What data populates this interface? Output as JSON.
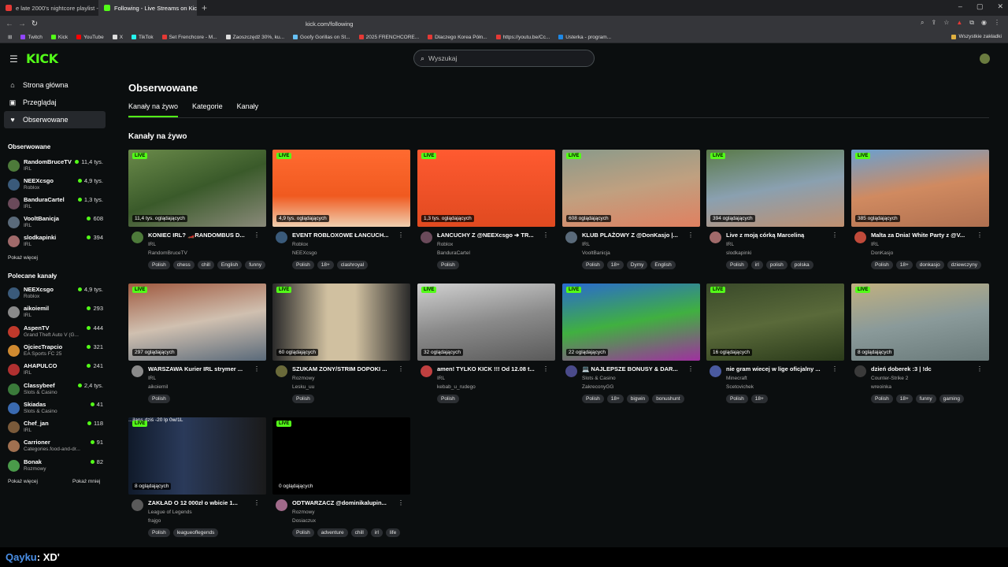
{
  "browser": {
    "tabs": [
      {
        "title": "e late 2000's nightcore playlist -",
        "active": false,
        "color": "#e53935"
      },
      {
        "title": "Following - Live Streams on Kick",
        "active": true,
        "color": "#53fc18"
      }
    ],
    "url": "kick.com/following",
    "bookmarks": [
      {
        "label": "Twitch",
        "color": "#9146ff"
      },
      {
        "label": "Kick",
        "color": "#53fc18"
      },
      {
        "label": "YouTube",
        "color": "#ff0000"
      },
      {
        "label": "X",
        "color": "#dddddd"
      },
      {
        "label": "TikTok",
        "color": "#25f4ee"
      },
      {
        "label": "Set Frenchcore - M...",
        "color": "#e53935"
      },
      {
        "label": "Zaoszczędź 30%, ku...",
        "color": "#dddddd"
      },
      {
        "label": "Goofy Gorillas on St...",
        "color": "#66c0f4"
      },
      {
        "label": "2025 FRENCHCORE...",
        "color": "#e53935"
      },
      {
        "label": "Dlaczego Korea Półn...",
        "color": "#e53935"
      },
      {
        "label": "https://youtu.be/Cc...",
        "color": "#e53935"
      },
      {
        "label": "Usterka - program...",
        "color": "#1e88e5"
      }
    ],
    "all_bookmarks": "Wszystkie zakładki"
  },
  "header": {
    "logo": "KICK",
    "search_placeholder": "Wyszukaj"
  },
  "sidebar": {
    "nav": [
      {
        "label": "Strona główna",
        "icon": "home-icon",
        "glyph": "⌂"
      },
      {
        "label": "Przeglądaj",
        "icon": "browse-icon",
        "glyph": "▣"
      },
      {
        "label": "Obserwowane",
        "icon": "heart-icon",
        "glyph": "♥"
      }
    ],
    "followed_title": "Obserwowane",
    "followed": [
      {
        "name": "RandomBruceTV",
        "category": "IRL",
        "viewers": "11,4 tys.",
        "color": "#4d7a3a"
      },
      {
        "name": "NEEXcsgo",
        "category": "Roblox",
        "viewers": "4,9 tys.",
        "color": "#3a5a7a"
      },
      {
        "name": "BanduraCartel",
        "category": "IRL",
        "viewers": "1,3 tys.",
        "color": "#6a4a5a"
      },
      {
        "name": "VooltBanicja",
        "category": "IRL",
        "viewers": "608",
        "color": "#5a6a7a"
      },
      {
        "name": "slodkapinki",
        "category": "IRL",
        "viewers": "394",
        "color": "#a06a6a"
      }
    ],
    "show_more": "Pokaż więcej",
    "recommended_title": "Polecane kanały",
    "recommended": [
      {
        "name": "NEEXcsgo",
        "category": "Roblox",
        "viewers": "4,9 tys.",
        "color": "#3a5a7a"
      },
      {
        "name": "aikoiemil",
        "category": "IRL",
        "viewers": "293",
        "color": "#8a8a8a"
      },
      {
        "name": "AspenTV",
        "category": "Grand Theft Auto V (G...",
        "viewers": "444",
        "color": "#c0392b"
      },
      {
        "name": "OjciecTrapcio",
        "category": "EA Sports FC 25",
        "viewers": "321",
        "color": "#d08a30"
      },
      {
        "name": "AHAPULCO",
        "category": "IRL",
        "viewers": "241",
        "color": "#b03030"
      },
      {
        "name": "Classybeef",
        "category": "Slots & Casino",
        "viewers": "2,4 tys.",
        "color": "#3a7a3a"
      },
      {
        "name": "Skiadas",
        "category": "Slots & Casino",
        "viewers": "41",
        "color": "#3a6ab0"
      },
      {
        "name": "Chef_jan",
        "category": "IRL",
        "viewers": "118",
        "color": "#7a5a3a"
      },
      {
        "name": "Carrioner",
        "category": "Categories.food-and-dr...",
        "viewers": "91",
        "color": "#a07050"
      },
      {
        "name": "Bonak",
        "category": "Rozmowy",
        "viewers": "82",
        "color": "#4a9a4a"
      }
    ],
    "show_more_2": "Pokaż więcej",
    "show_less": "Pokaż mniej"
  },
  "main": {
    "title": "Obserwowane",
    "tabs": [
      "Kanały na żywo",
      "Kategorie",
      "Kanały"
    ],
    "section_title": "Kanały na żywo",
    "live_label": "LIVE",
    "cards": [
      {
        "title": "KONIEC IRL? 🏎️RANDOMBUS D...",
        "category": "IRL",
        "user": "RandomBruceTV",
        "viewers": "11,4 tys. oglądających",
        "tags": [
          "Polish",
          "chess",
          "chill",
          "English",
          "funny"
        ],
        "thumb": "linear-gradient(160deg,#6a8a4a,#3a5a2a 50%,#8a8a7a)",
        "av": "#4d7a3a"
      },
      {
        "title": "EVENT ROBLOXOWE ŁANCUCH...",
        "category": "Roblox",
        "user": "NEEXcsgo",
        "viewers": "4,9 tys. oglądających",
        "tags": [
          "Polish",
          "18+",
          "clashroyal"
        ],
        "thumb": "linear-gradient(180deg,#ff6a30,#f05a20 60%,#f0d0b0)",
        "av": "#3a5a7a"
      },
      {
        "title": "ŁANCUCHY Z @NEEXcsgo ➔ TR...",
        "category": "Roblox",
        "user": "BanduraCartel",
        "viewers": "1,3 tys. oglądających",
        "tags": [
          "Polish"
        ],
        "thumb": "linear-gradient(180deg,#ff5a30,#e04a20)",
        "av": "#6a4a5a"
      },
      {
        "title": "KLUB PLAŻOWY Z @DonKasjo |...",
        "category": "IRL",
        "user": "VooltBanicja",
        "viewers": "608 oglądających",
        "tags": [
          "Polish",
          "18+",
          "Dymy",
          "English"
        ],
        "thumb": "linear-gradient(170deg,#8a9a8a,#c0a080 50%,#e08060)",
        "av": "#5a6a7a"
      },
      {
        "title": "Live z moją córką Marceliną",
        "category": "IRL",
        "user": "slodkapinki",
        "viewers": "394 oglądających",
        "tags": [
          "Polish",
          "irl",
          "polish",
          "polska"
        ],
        "thumb": "linear-gradient(170deg,#5a7a4a,#8aa0b0 50%,#c09070)",
        "av": "#a06a6a"
      },
      {
        "title": "Malta za Dnia! White Party z @V...",
        "category": "IRL",
        "user": "DonKasjo",
        "viewers": "385 oglądających",
        "tags": [
          "Polish",
          "18+",
          "donkasjo",
          "dziewczyny"
        ],
        "thumb": "linear-gradient(170deg,#6aa0d0,#d08a60 50%,#b07050)",
        "av": "#c04a3a"
      },
      {
        "title": "WARSZAWA Kurier IRL strymer ...",
        "category": "IRL",
        "user": "aikoiemil",
        "viewers": "297 oglądających",
        "tags": [
          "Polish"
        ],
        "thumb": "linear-gradient(170deg,#a05a40,#d0c0b0 50%,#5a6a7a)",
        "av": "#8a8a8a"
      },
      {
        "title": "SZUKAM ZONY/STRIM DOPOKI ...",
        "category": "Rozmowy",
        "user": "Lesku_uu",
        "viewers": "60 oglądających",
        "tags": [
          "Polish"
        ],
        "thumb": "linear-gradient(90deg,#2a2a2a,#d0c0a0 40%,#d0c0a0 60%,#2a2a2a)",
        "av": "#6a6a3a"
      },
      {
        "title": "amen! TYLKO KICK !!! Od 12.08 t...",
        "category": "IRL",
        "user": "kebab_u_rudego",
        "viewers": "32 oglądających",
        "tags": [
          "Polish"
        ],
        "thumb": "linear-gradient(170deg,#d0d0d0,#8a8a8a 50%,#5a5a5a)",
        "av": "#c04040"
      },
      {
        "title": "💻 NAJLEPSZE BONUSY & DAR...",
        "category": "Slots & Casino",
        "user": "ZakreconyGG",
        "viewers": "22 oglądających",
        "tags": [
          "Polish",
          "18+",
          "bigwin",
          "bonushunt"
        ],
        "thumb": "linear-gradient(170deg,#2a6ad0,#40b040 50%,#a030a0)",
        "av": "#4a4a8a"
      },
      {
        "title": "nie gram wiecej w lige oficjalny ...",
        "category": "Minecraft",
        "user": "Scetovichek",
        "viewers": "16 oglądających",
        "tags": [
          "Polish",
          "18+"
        ],
        "thumb": "linear-gradient(170deg,#3a4a2a,#5a6a3a 50%,#2a3a1a)",
        "av": "#4a5aa0"
      },
      {
        "title": "dzień doberek :3 | !dc",
        "category": "Counter-Strike 2",
        "user": "wreoinka",
        "viewers": "8 oglądających",
        "tags": [
          "Polish",
          "18+",
          "funny",
          "gaming"
        ],
        "thumb": "linear-gradient(170deg,#c0b080,#8a9a9a 50%,#6a7a7a)",
        "av": "#3a3a3a"
      },
      {
        "title": "ZAKŁAD O 12 000zł o wbicie 1...",
        "category": "League of Legends",
        "user": "frajgo",
        "viewers": "8 oglądających",
        "tags": [
          "Polish",
          "leagueoflegends"
        ],
        "thumb": "linear-gradient(90deg,#101a2a,#2a3a5a 40%,#1a1a1a)",
        "av": "#5a5a5a",
        "overlay": "...ilans  dziś -20 lp 0w/1L"
      },
      {
        "title": "ODTWARZACZ @dominikalupin...",
        "category": "Rozmowy",
        "user": "Dosiaczux",
        "viewers": "0 oglądających",
        "tags": [
          "Polish",
          "adventure",
          "chill",
          "irl",
          "life"
        ],
        "thumb": "#000000",
        "av": "#a06a8a"
      }
    ]
  },
  "chat": {
    "user": "Qayku",
    "message": ": XD'"
  }
}
